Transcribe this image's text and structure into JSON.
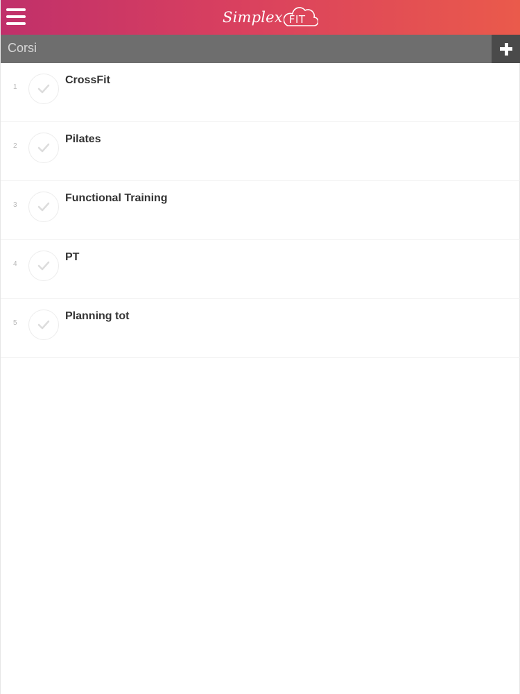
{
  "header": {
    "logo": {
      "text": "Simplex",
      "badge": "FIT"
    },
    "menu_icon": "hamburger-menu-icon",
    "gradient": {
      "start": "#c0306a",
      "end": "#ea5a4b"
    }
  },
  "section": {
    "title": "Corsi",
    "add_icon": "plus-icon",
    "bar_color": "#6e6e6e",
    "add_color": "#4a4a4a"
  },
  "courses": [
    {
      "number": "1",
      "name": "CrossFit"
    },
    {
      "number": "2",
      "name": "Pilates"
    },
    {
      "number": "3",
      "name": "Functional Training"
    },
    {
      "number": "4",
      "name": "PT"
    },
    {
      "number": "5",
      "name": "Planning tot"
    }
  ]
}
